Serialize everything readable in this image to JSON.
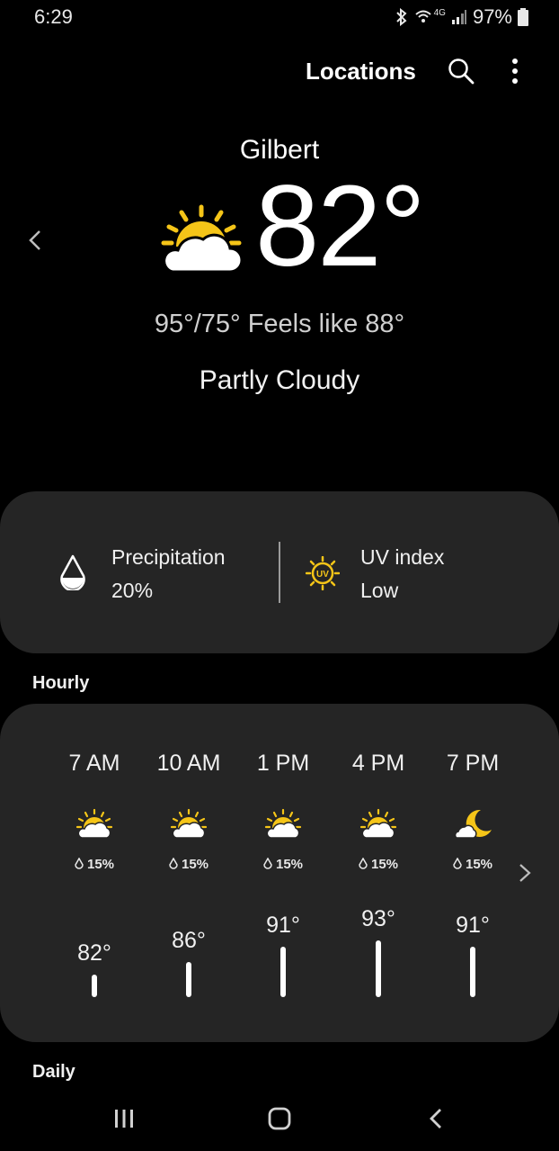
{
  "status": {
    "time": "6:29",
    "battery": "97%",
    "network": "4G"
  },
  "header": {
    "title": "Locations"
  },
  "weather": {
    "city": "Gilbert",
    "temperature": "82°",
    "hi_lo_feels": "95°/75° Feels like 88°",
    "condition": "Partly Cloudy"
  },
  "details": {
    "precip_label": "Precipitation",
    "precip_value": "20%",
    "uv_label": "UV index",
    "uv_value": "Low",
    "uv_badge": "UV"
  },
  "sections": {
    "hourly": "Hourly",
    "daily": "Daily"
  },
  "hourly": [
    {
      "time": "7 AM",
      "icon": "partly-cloudy-day-icon",
      "precip": "15%",
      "temp": "82°",
      "temp_value": 82
    },
    {
      "time": "10 AM",
      "icon": "partly-cloudy-day-icon",
      "precip": "15%",
      "temp": "86°",
      "temp_value": 86
    },
    {
      "time": "1 PM",
      "icon": "partly-cloudy-day-icon",
      "precip": "15%",
      "temp": "91°",
      "temp_value": 91
    },
    {
      "time": "4 PM",
      "icon": "partly-cloudy-day-icon",
      "precip": "15%",
      "temp": "93°",
      "temp_value": 93
    },
    {
      "time": "7 PM",
      "icon": "partly-cloudy-night-icon",
      "precip": "15%",
      "temp": "91°",
      "temp_value": 91
    }
  ],
  "colors": {
    "sun": "#f5c518",
    "card": "#252525",
    "background": "#000000"
  }
}
